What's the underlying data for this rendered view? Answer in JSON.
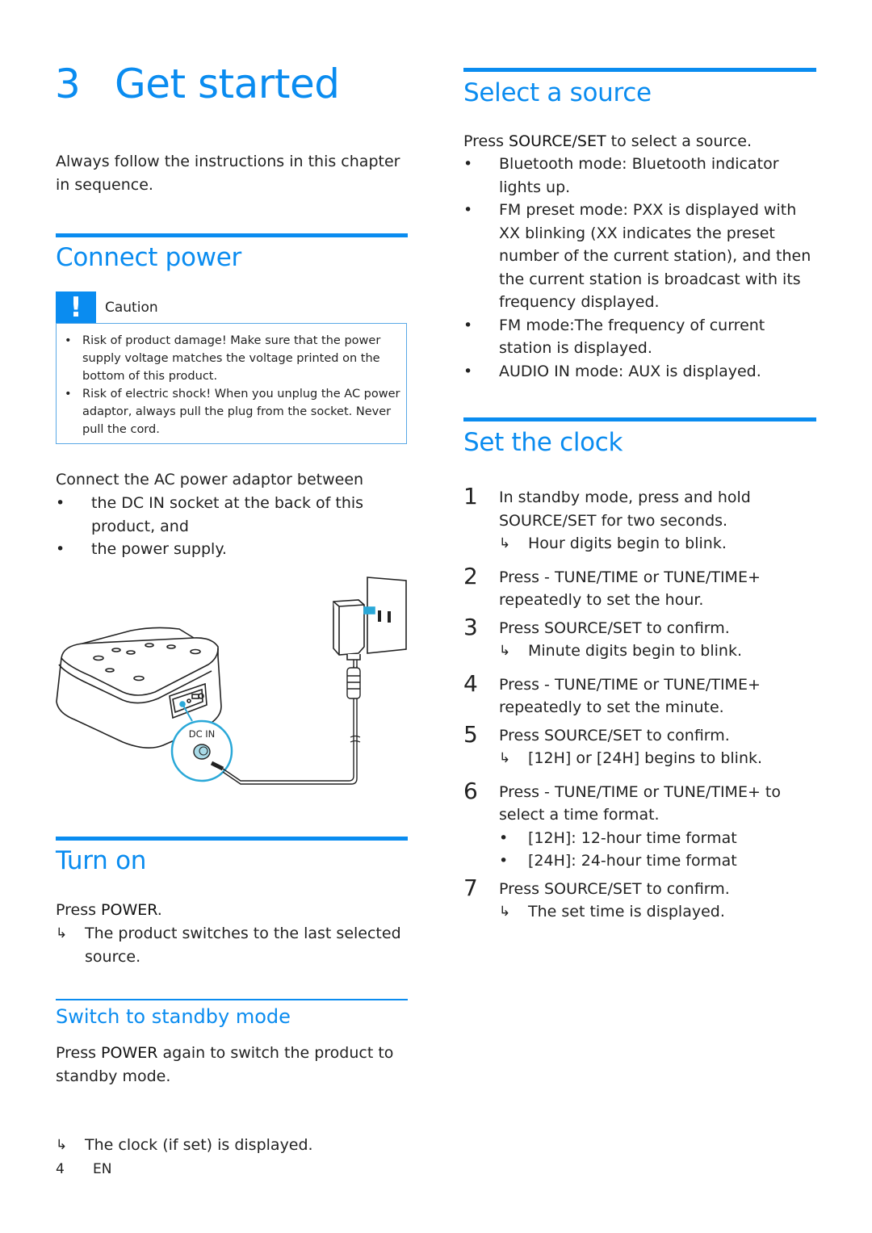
{
  "chapter": {
    "number": "3",
    "title": "Get started",
    "intro": "Always follow the instructions in this chapter in sequence."
  },
  "connect_power": {
    "heading": "Connect power",
    "caution": {
      "icon": "exclamation-icon",
      "label": "Caution",
      "items": [
        "Risk of product damage! Make sure that the power supply voltage matches the voltage printed on the bottom of this product.",
        "Risk of electric shock! When you unplug the AC power adaptor, always pull the plug from the socket. Never pull the cord."
      ]
    },
    "intro": "Connect the AC power adaptor between",
    "bullets": [
      {
        "pre": "the ",
        "kw": "DC IN",
        "post": " socket at the back of this product, and"
      },
      {
        "pre": "the power supply.",
        "kw": "",
        "post": ""
      }
    ],
    "illustration": {
      "callout_label": "DC IN",
      "accent_color": "#2aa8d8"
    }
  },
  "turn_on": {
    "heading": "Turn on",
    "instruction_pre": "Press ",
    "instruction_kw": "POWER",
    "instruction_post": ".",
    "result": "The product switches to the last selected source."
  },
  "standby": {
    "heading": "Switch to standby mode",
    "instruction_pre": "Press ",
    "instruction_kw": "POWER",
    "instruction_post": " again to switch the product to standby mode.",
    "result": "The clock (if set) is displayed."
  },
  "select_source": {
    "heading": "Select a source",
    "instruction_pre": "Press ",
    "instruction_kw": "SOURCE/SET",
    "instruction_post": " to select a source.",
    "bullets": [
      {
        "pre": "Bluetooth mode: Bluetooth indicator lights up.",
        "kw": "",
        "post": ""
      },
      {
        "pre": "FM preset mode: ",
        "kw": "PXX",
        "post": " is displayed with XX blinking (XX indicates the preset number of the current station), and then the current station is broadcast with its frequency displayed."
      },
      {
        "pre": "FM mode:The frequency of current station is displayed.",
        "kw": "",
        "post": ""
      },
      {
        "pre": "AUDIO IN mode: ",
        "kw": "AUX",
        "post": " is displayed."
      }
    ]
  },
  "set_clock": {
    "heading": "Set the clock",
    "steps": [
      {
        "num": "1",
        "pre": "In standby mode, press and hold ",
        "kw": "SOURCE/SET",
        "post": " for two seconds.",
        "result": "Hour digits begin to blink."
      },
      {
        "num": "2",
        "pre": "Press ",
        "kw": "- TUNE/TIME",
        "mid": " or ",
        "kw2": "TUNE/TIME+",
        "post": " repeatedly to set the hour."
      },
      {
        "num": "3",
        "pre": "Press ",
        "kw": "SOURCE/SET",
        "post": " to confirm.",
        "result": "Minute digits begin to blink."
      },
      {
        "num": "4",
        "pre": "Press ",
        "kw": "- TUNE/TIME",
        "mid": " or ",
        "kw2": "TUNE/TIME+",
        "post": " repeatedly to set the minute."
      },
      {
        "num": "5",
        "pre": "Press ",
        "kw": "SOURCE/SET",
        "post": " to confirm.",
        "result_kw1": "[12H]",
        "result_mid": " or ",
        "result_kw2": "[24H]",
        "result_post": " begins to blink."
      },
      {
        "num": "6",
        "pre": "Press ",
        "kw": "- TUNE/TIME",
        "mid": " or ",
        "kw2": "TUNE/TIME+",
        "post": " to select a time format.",
        "options": [
          {
            "kw": "[12H]",
            "text": ": 12-hour time format"
          },
          {
            "kw": "[24H]",
            "text": ": 24-hour time format"
          }
        ]
      },
      {
        "num": "7",
        "pre": "Press ",
        "kw": "SOURCE/SET",
        "post": " to confirm.",
        "result": "The set time is displayed."
      }
    ]
  },
  "footer": {
    "page_number": "4",
    "language": "EN"
  },
  "symbols": {
    "bullet": "•",
    "result_arrow": "↳"
  }
}
